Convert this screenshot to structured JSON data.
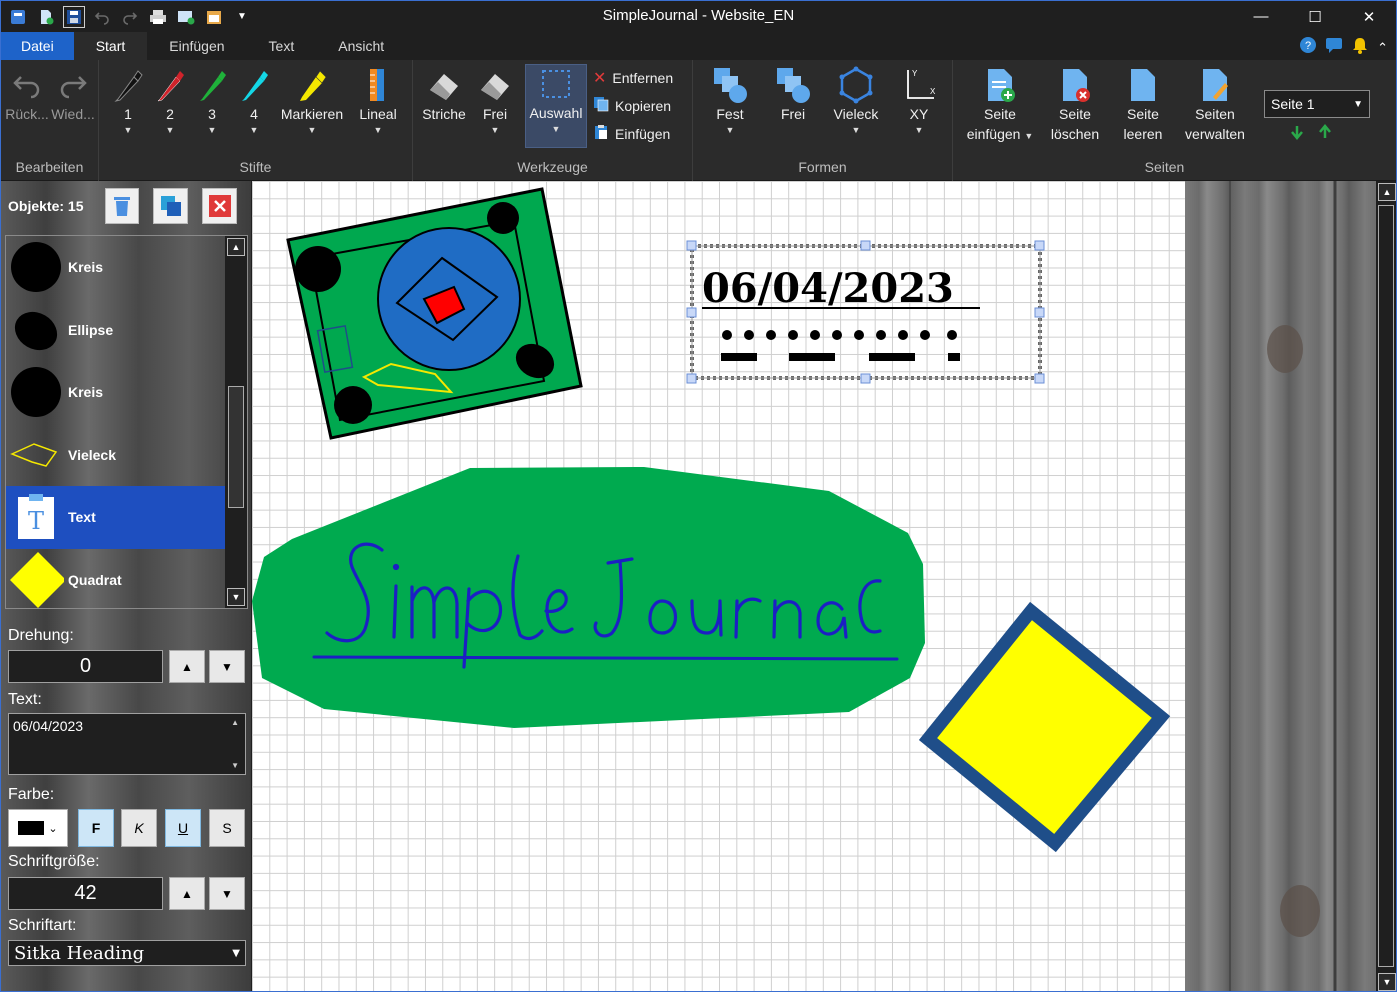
{
  "window": {
    "title": "SimpleJournal - Website_EN",
    "minimize": "—",
    "maximize": "☐",
    "close": "✕"
  },
  "tabs": [
    {
      "label": "Datei"
    },
    {
      "label": "Start"
    },
    {
      "label": "Einfügen"
    },
    {
      "label": "Text"
    },
    {
      "label": "Ansicht"
    }
  ],
  "ribbon": {
    "edit": {
      "title": "Bearbeiten",
      "undo": "Rück...",
      "redo": "Wied..."
    },
    "pens": {
      "title": "Stifte",
      "p1": "1",
      "p2": "2",
      "p3": "3",
      "p4": "4",
      "highlight": "Markieren",
      "ruler": "Lineal"
    },
    "tools": {
      "title": "Werkzeuge",
      "strokes": "Striche",
      "free": "Frei",
      "select": "Auswahl",
      "remove": "Entfernen",
      "copy": "Kopieren",
      "paste": "Einfügen"
    },
    "shapes": {
      "title": "Formen",
      "fixed": "Fest",
      "free": "Frei",
      "polygon": "Vieleck",
      "xy": "XY"
    },
    "pages": {
      "title": "Seiten",
      "insert1": "Seite",
      "insert2": "einfügen",
      "delete1": "Seite",
      "delete2": "löschen",
      "clear1": "Seite",
      "clear2": "leeren",
      "manage1": "Seiten",
      "manage2": "verwalten",
      "current_page": "Seite 1"
    }
  },
  "panel": {
    "objects_label": "Objekte: 15",
    "objects": [
      {
        "label": "Kreis"
      },
      {
        "label": "Ellipse"
      },
      {
        "label": "Kreis"
      },
      {
        "label": "Vieleck"
      },
      {
        "label": "Text"
      },
      {
        "label": "Quadrat"
      }
    ],
    "rotation_label": "Drehung:",
    "rotation_value": "0",
    "text_label": "Text:",
    "text_value": "06/04/2023",
    "color_label": "Farbe:",
    "bold": "F",
    "italic": "K",
    "underline": "U",
    "strike": "S",
    "fontsize_label": "Schriftgröße:",
    "fontsize_value": "42",
    "font_label": "Schriftart:",
    "font_value": "Sitka Heading"
  },
  "canvas": {
    "date_text": "06/04/2023",
    "handwriting": "Simple Journal"
  },
  "colors": {
    "accent": "#1e63c9",
    "green": "#00aa44",
    "yellow": "#ffff00",
    "navy": "#1f4e89",
    "blue_ink": "#1c1fc4"
  }
}
